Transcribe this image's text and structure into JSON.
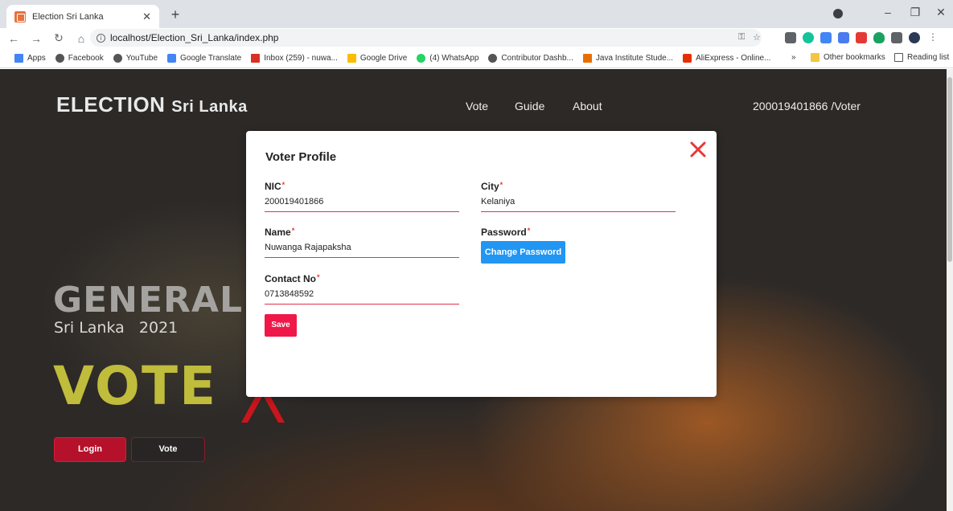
{
  "browser": {
    "tab_title": "Election Sri Lanka",
    "url": "localhost/Election_Sri_Lanka/index.php",
    "bookmarks": [
      "Apps",
      "Facebook",
      "YouTube",
      "Google Translate",
      "Inbox (259) - nuwa...",
      "Google Drive",
      "(4) WhatsApp",
      "Contributor Dashb...",
      "Java Institute Stude...",
      "AliExpress - Online..."
    ],
    "other_bookmarks": "Other bookmarks",
    "reading_list": "Reading list"
  },
  "header": {
    "logo_main": "ELECTION",
    "logo_sub": "Sri Lanka",
    "nav": [
      "Vote",
      "Guide",
      "About"
    ],
    "user": "200019401866 /Voter"
  },
  "hero": {
    "title": "GENERAL ELI",
    "subtitle": "Sri Lanka   2021",
    "vote": "VOTE",
    "login_label": "Login",
    "vote_label": "Vote"
  },
  "modal": {
    "title": "Voter Profile",
    "nic_label": "NIC",
    "nic_value": "200019401866",
    "city_label": "City",
    "city_value": "Kelaniya",
    "name_label": "Name",
    "name_value": "Nuwanga Rajapaksha",
    "password_label": "Password",
    "change_password_label": "Change Password",
    "contact_label": "Contact No",
    "contact_value": "0713848592",
    "save_label": "Save",
    "required_mark": "*"
  },
  "colors": {
    "accent_red": "#f01848",
    "accent_blue": "#2196f3",
    "vote_yellow": "#c0bc3c"
  }
}
